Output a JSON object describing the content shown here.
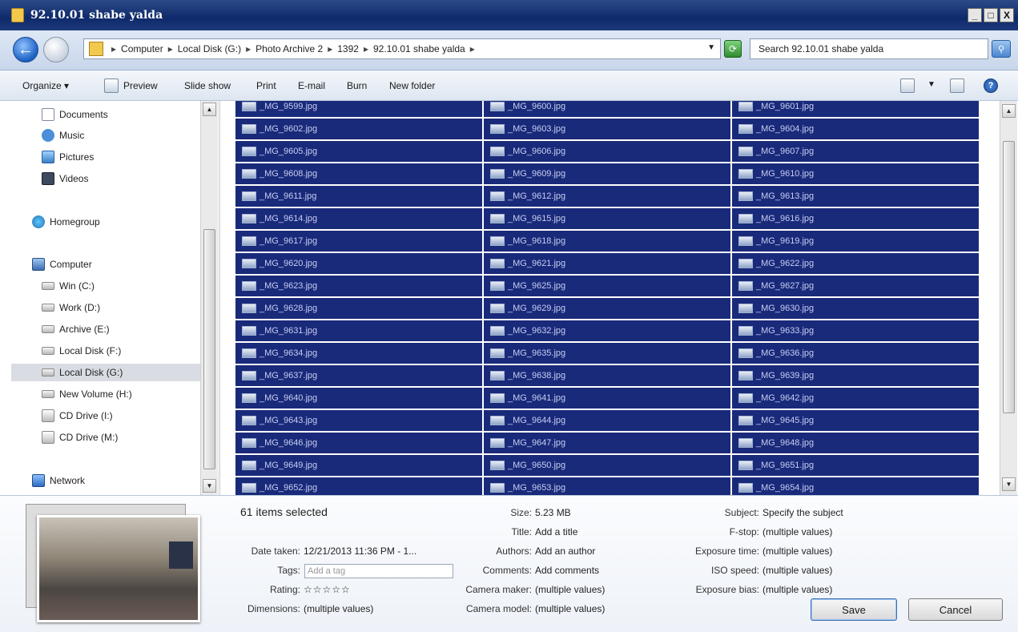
{
  "window": {
    "title": "92.10.01 shabe yalda",
    "controls": [
      "_",
      "□",
      "X"
    ]
  },
  "address": {
    "crumbs": [
      "Computer",
      "Local Disk (G:)",
      "Photo Archive 2",
      "1392",
      "92.10.01 shabe yalda"
    ],
    "search_placeholder": "Search 92.10.01 shabe yalda"
  },
  "toolbar": {
    "organize": "Organize ▾",
    "preview": "Preview",
    "slideshow": "Slide show",
    "print": "Print",
    "email": "E-mail",
    "burn": "Burn",
    "new_folder": "New folder"
  },
  "nav": {
    "items": [
      {
        "label": "Documents",
        "icon": "documents-icon"
      },
      {
        "label": "Music",
        "icon": "music-icon"
      },
      {
        "label": "Pictures",
        "icon": "pictures-icon"
      },
      {
        "label": "Videos",
        "icon": "videos-icon"
      },
      {
        "label": "Homegroup",
        "icon": "homegroup-icon"
      },
      {
        "label": "Computer",
        "icon": "computer-icon"
      },
      {
        "label": "Win (C:)",
        "icon": "drive-icon"
      },
      {
        "label": "Work (D:)",
        "icon": "drive-icon"
      },
      {
        "label": "Archive (E:)",
        "icon": "drive-icon"
      },
      {
        "label": "Local Disk (F:)",
        "icon": "drive-icon"
      },
      {
        "label": "Local Disk (G:)",
        "icon": "drive-icon",
        "selected": true
      },
      {
        "label": "New Volume (H:)",
        "icon": "drive-icon"
      },
      {
        "label": "CD Drive (I:)",
        "icon": "cd-drive-icon"
      },
      {
        "label": "CD Drive (M:)",
        "icon": "cd-drive-icon"
      },
      {
        "label": "Network",
        "icon": "network-icon"
      }
    ]
  },
  "files": [
    [
      "_MG_9599.jpg",
      "_MG_9600.jpg",
      "_MG_9601.jpg"
    ],
    [
      "_MG_9602.jpg",
      "_MG_9603.jpg",
      "_MG_9604.jpg"
    ],
    [
      "_MG_9605.jpg",
      "_MG_9606.jpg",
      "_MG_9607.jpg"
    ],
    [
      "_MG_9608.jpg",
      "_MG_9609.jpg",
      "_MG_9610.jpg"
    ],
    [
      "_MG_9611.jpg",
      "_MG_9612.jpg",
      "_MG_9613.jpg"
    ],
    [
      "_MG_9614.jpg",
      "_MG_9615.jpg",
      "_MG_9616.jpg"
    ],
    [
      "_MG_9617.jpg",
      "_MG_9618.jpg",
      "_MG_9619.jpg"
    ],
    [
      "_MG_9620.jpg",
      "_MG_9621.jpg",
      "_MG_9622.jpg"
    ],
    [
      "_MG_9623.jpg",
      "_MG_9625.jpg",
      "_MG_9627.jpg"
    ],
    [
      "_MG_9628.jpg",
      "_MG_9629.jpg",
      "_MG_9630.jpg"
    ],
    [
      "_MG_9631.jpg",
      "_MG_9632.jpg",
      "_MG_9633.jpg"
    ],
    [
      "_MG_9634.jpg",
      "_MG_9635.jpg",
      "_MG_9636.jpg"
    ],
    [
      "_MG_9637.jpg",
      "_MG_9638.jpg",
      "_MG_9639.jpg"
    ],
    [
      "_MG_9640.jpg",
      "_MG_9641.jpg",
      "_MG_9642.jpg"
    ],
    [
      "_MG_9643.jpg",
      "_MG_9644.jpg",
      "_MG_9645.jpg"
    ],
    [
      "_MG_9646.jpg",
      "_MG_9647.jpg",
      "_MG_9648.jpg"
    ],
    [
      "_MG_9649.jpg",
      "_MG_9650.jpg",
      "_MG_9651.jpg"
    ],
    [
      "_MG_9652.jpg",
      "_MG_9653.jpg",
      "_MG_9654.jpg"
    ]
  ],
  "details": {
    "count": "61 items selected",
    "date_taken_label": "Date taken:",
    "date_taken": "12/21/2013 11:36 PM - 1...",
    "tags_label": "Tags:",
    "tags_placeholder": "Add a tag",
    "rating_label": "Rating:",
    "rating_stars": "☆☆☆☆☆",
    "dimensions_label": "Dimensions:",
    "dimensions": "(multiple values)",
    "size_label": "Size:",
    "size": "5.23 MB",
    "title_label": "Title:",
    "title": "Add a title",
    "authors_label": "Authors:",
    "authors": "Add an author",
    "comments_label": "Comments:",
    "comments": "Add comments",
    "camera_maker_label": "Camera maker:",
    "camera_maker": "(multiple values)",
    "camera_model_label": "Camera model:",
    "camera_model": "(multiple values)",
    "subject_label": "Subject:",
    "subject": "Specify the subject",
    "fstop_label": "F-stop:",
    "fstop": "(multiple values)",
    "exposure_time_label": "Exposure time:",
    "exposure_time": "(multiple values)",
    "iso_label": "ISO speed:",
    "iso": "(multiple values)",
    "exposure_bias_label": "Exposure bias:",
    "exposure_bias": "(multiple values)"
  },
  "buttons": {
    "save": "Save",
    "cancel": "Cancel"
  }
}
